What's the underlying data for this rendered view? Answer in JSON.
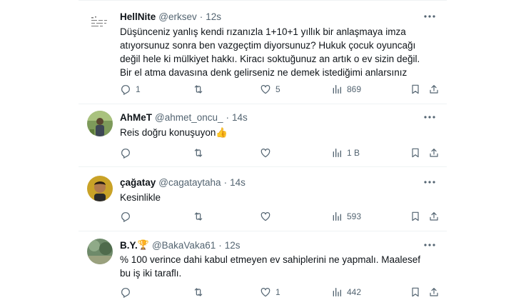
{
  "tweets": [
    {
      "name": "HellNite",
      "name_emoji": "",
      "handle": "@erksev",
      "dot": "·",
      "time": "12s",
      "text": "Düşünceniz yanlış kendi rızanızla 1+10+1 yıllık bir anlaşmaya imza atıyorsunuz sonra ben vazgeçtim diyorsunuz? Hukuk çocuk oyuncağı değil hele ki mülkiyet hakkı. Kiracı soktuğunuz an artık o ev sizin değil. Bir el atma davasına denk gelirseniz ne demek istediğimi anlarsınız",
      "reply_count": "1",
      "retweet_count": "",
      "like_count": "5",
      "view_count": "869"
    },
    {
      "name": "AhMeT",
      "name_emoji": "",
      "handle": "@ahmet_oncu_",
      "dot": "·",
      "time": "14s",
      "text": "Reis doğru konuşuyon",
      "text_emoji": "👍",
      "reply_count": "",
      "retweet_count": "",
      "like_count": "",
      "view_count": "1 B"
    },
    {
      "name": "çağatay",
      "name_emoji": "",
      "handle": "@cagataytaha",
      "dot": "·",
      "time": "14s",
      "text": "Kesinlikle",
      "reply_count": "",
      "retweet_count": "",
      "like_count": "",
      "view_count": "593"
    },
    {
      "name": "B.Y.",
      "name_emoji": "🏆",
      "handle": "@BakaVaka61",
      "dot": "·",
      "time": "12s",
      "text": "% 100 verince dahi kabul etmeyen ev sahiplerini ne yapmalı. Maalesef bu iş iki taraflı.",
      "reply_count": "",
      "retweet_count": "",
      "like_count": "1",
      "view_count": "442"
    }
  ],
  "icons": {
    "more": "more-dots-icon",
    "reply": "reply-icon",
    "retweet": "retweet-icon",
    "like": "like-icon",
    "views": "views-icon",
    "bookmark": "bookmark-icon",
    "share": "share-icon"
  },
  "colors": {
    "text": "#0f1419",
    "secondary": "#536471",
    "divider": "#eff3f4"
  }
}
